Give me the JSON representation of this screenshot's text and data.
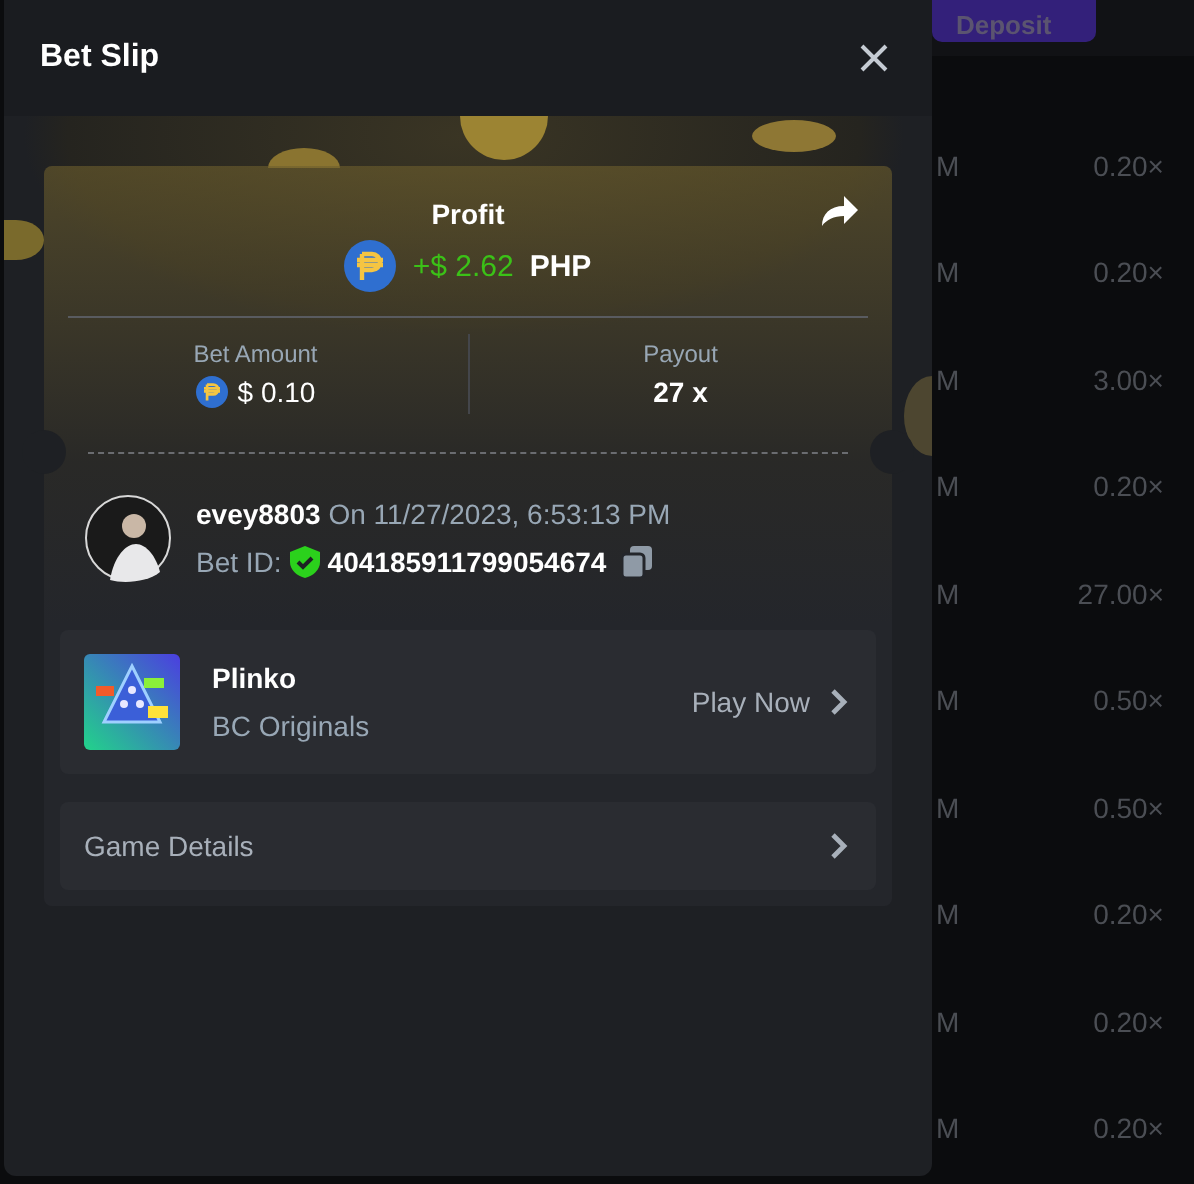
{
  "background": {
    "deposit_button": "Deposit",
    "rows": [
      {
        "column_1": "M",
        "multiplier": "0.20×"
      },
      {
        "column_1": "M",
        "multiplier": "0.20×"
      },
      {
        "column_1": "M",
        "multiplier": "3.00×"
      },
      {
        "column_1": "M",
        "multiplier": "0.20×"
      },
      {
        "column_1": "M",
        "multiplier": "27.00×"
      },
      {
        "column_1": "M",
        "multiplier": "0.50×"
      },
      {
        "column_1": "M",
        "multiplier": "0.50×"
      },
      {
        "column_1": "M",
        "multiplier": "0.20×"
      },
      {
        "column_1": "M",
        "multiplier": "0.20×"
      },
      {
        "column_1": "M",
        "multiplier": "0.20×"
      }
    ]
  },
  "bet_slip": {
    "title": "Bet Slip",
    "profit": {
      "label": "Profit",
      "amount": "+$ 2.62",
      "currency": "PHP"
    },
    "bet_amount": {
      "label": "Bet Amount",
      "value": "$ 0.10"
    },
    "payout": {
      "label": "Payout",
      "value": "27 x"
    },
    "user": {
      "name": "evey8803",
      "date": "On 11/27/2023, 6:53:13 PM",
      "bet_id_label": "Bet ID:",
      "bet_id": "404185911799054674"
    },
    "game": {
      "name": "Plinko",
      "provider": "BC Originals",
      "action": "Play Now"
    },
    "details": {
      "label": "Game Details"
    }
  }
}
